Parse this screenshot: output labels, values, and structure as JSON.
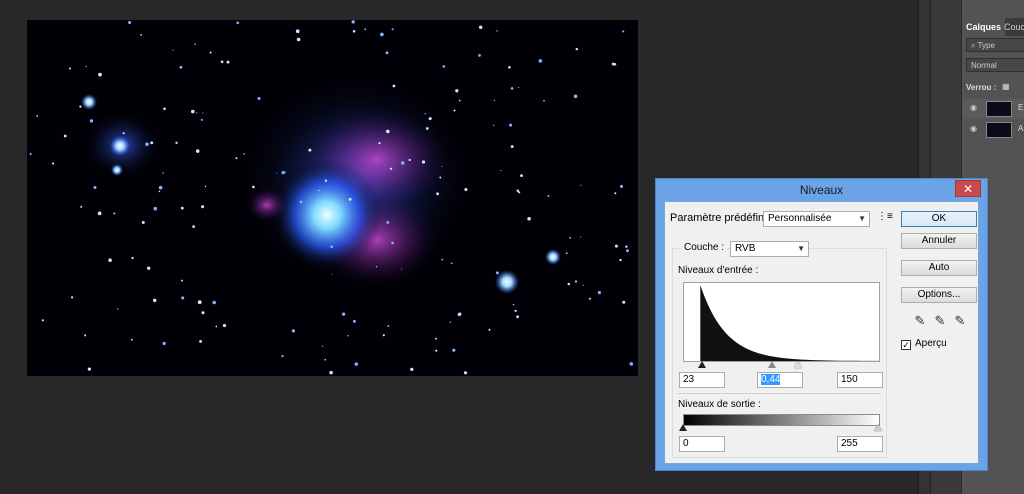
{
  "colors": {
    "workspace_bg": "#282828",
    "dialog_frame": "#6ba4e6",
    "close_button": "#c84b4b",
    "nebula_blue": "#4a6cff",
    "nebula_magenta": "#c23ec7"
  },
  "layers_panel": {
    "tabs": [
      "Calques",
      "Couc"
    ],
    "filter_label": "Type",
    "blend_mode": "Normal",
    "lock_label": "Verrou :",
    "layers": [
      {
        "name": "E",
        "visible": true
      },
      {
        "name": "A",
        "visible": true
      }
    ]
  },
  "dialog": {
    "title": "Niveaux",
    "close_icon": "close-icon",
    "preset_label": "Paramètre prédéfini :",
    "preset_value": "Personnalisée",
    "channel_label": "Couche :",
    "channel_value": "RVB",
    "input_levels_label": "Niveaux d'entrée :",
    "input_black": "23",
    "input_gamma": "0,44",
    "input_white": "150",
    "output_levels_label": "Niveaux de sortie :",
    "output_black": "0",
    "output_white": "255",
    "buttons": {
      "ok": "OK",
      "cancel": "Annuler",
      "auto": "Auto",
      "options": "Options..."
    },
    "preview_label": "Aperçu",
    "preview_checked": true,
    "histogram_peak_level": 23,
    "histogram_tail_level": 150
  }
}
